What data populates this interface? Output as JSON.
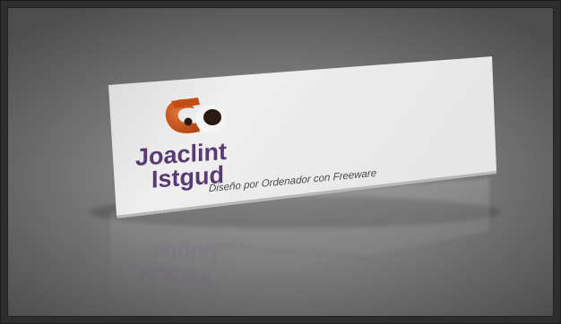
{
  "logo": {
    "name_line1": "Joaclint",
    "name_line2": "Istgud",
    "tagline": "Diseño por Ordenador con Freeware",
    "colors": {
      "mark_orange": "#c24e14",
      "mark_dark": "#2a1a14",
      "text_purple": "#5a3a73",
      "card": "#ececec"
    }
  }
}
